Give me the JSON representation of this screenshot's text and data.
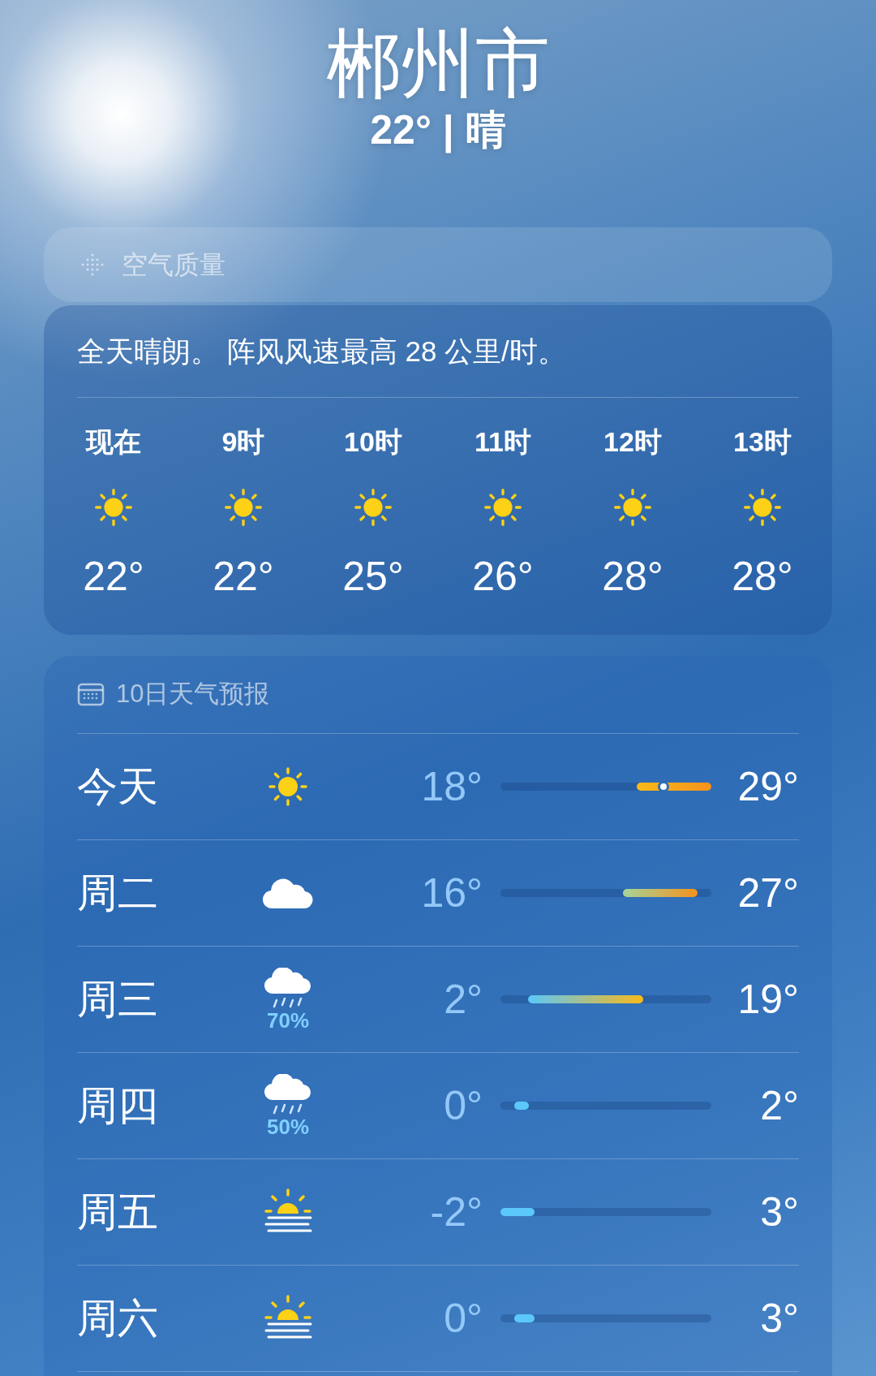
{
  "location": {
    "city": "郴州市",
    "summary": "22° | 晴"
  },
  "air_quality": {
    "title": "空气质量"
  },
  "hourly": {
    "description": "全天晴朗。 阵风风速最高 28 公里/时。",
    "hours": [
      {
        "label": "现在",
        "kind": "sun",
        "temp": "22°"
      },
      {
        "label": "9时",
        "kind": "sun",
        "temp": "22°"
      },
      {
        "label": "10时",
        "kind": "sun",
        "temp": "25°"
      },
      {
        "label": "11时",
        "kind": "sun",
        "temp": "26°"
      },
      {
        "label": "12时",
        "kind": "sun",
        "temp": "28°"
      },
      {
        "label": "13时",
        "kind": "sun",
        "temp": "28°"
      }
    ]
  },
  "forecast": {
    "title": "10日天气预报",
    "days": [
      {
        "day": "今天",
        "kind": "sun",
        "low": "18°",
        "high": "29°",
        "current": true
      },
      {
        "day": "周二",
        "kind": "cloud",
        "low": "16°",
        "high": "27°",
        "current": false
      },
      {
        "day": "周三",
        "kind": "rain",
        "chance": "70%",
        "low": "2°",
        "high": "19°",
        "current": false
      },
      {
        "day": "周四",
        "kind": "rain",
        "chance": "50%",
        "low": "0°",
        "high": "2°",
        "current": false
      },
      {
        "day": "周五",
        "kind": "haze",
        "low": "-2°",
        "high": "3°",
        "current": false
      },
      {
        "day": "周六",
        "kind": "haze",
        "low": "0°",
        "high": "3°",
        "current": false
      }
    ]
  }
}
